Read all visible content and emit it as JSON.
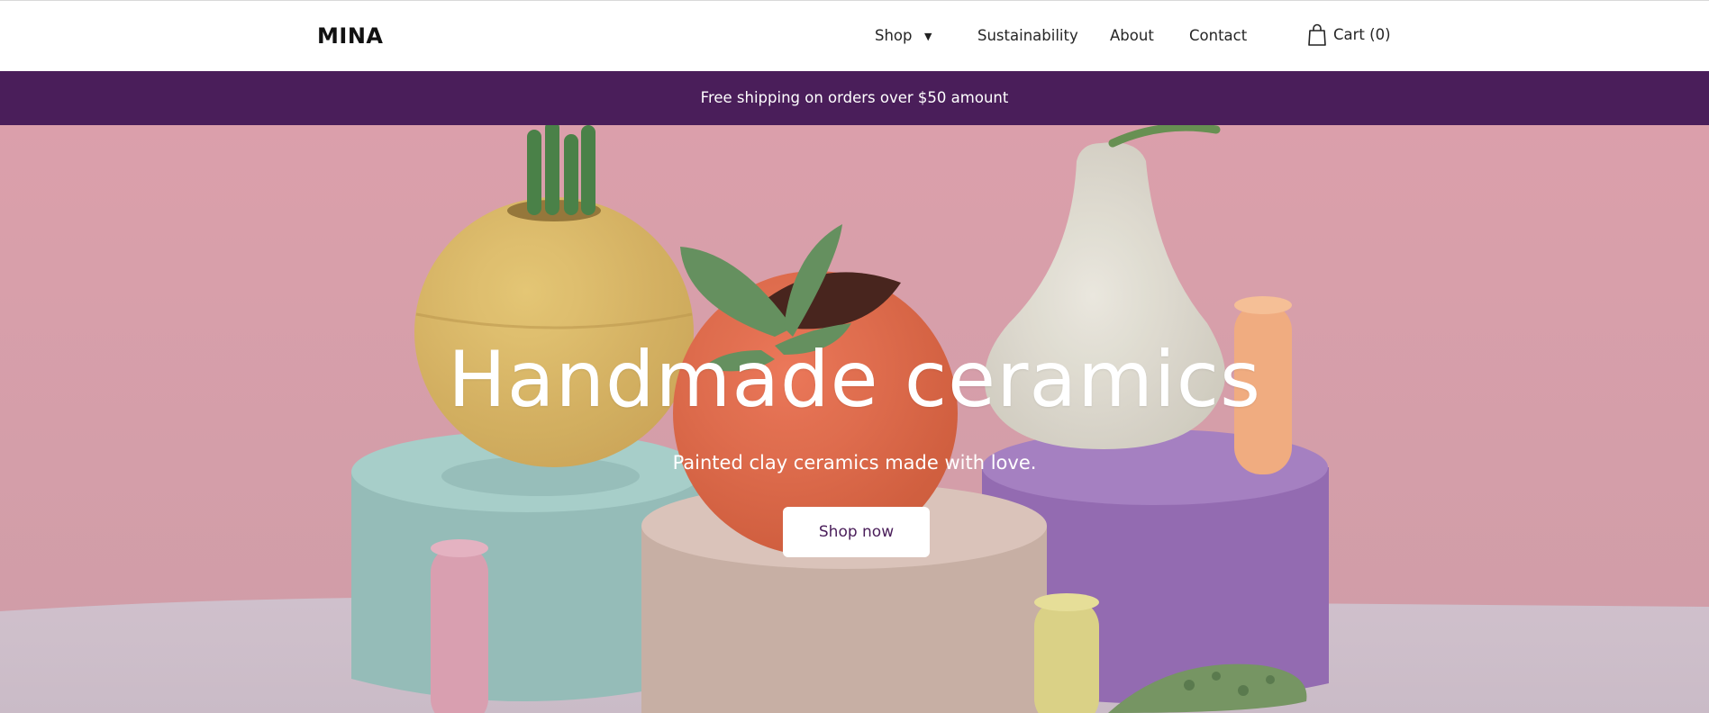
{
  "header": {
    "logo": "MINA",
    "nav": {
      "shop": "Shop",
      "sustainability": "Sustainability",
      "about": "About",
      "contact": "Contact"
    },
    "cart_label": "Cart (0)"
  },
  "announcement": {
    "text": "Free shipping on orders over $50 amount"
  },
  "hero": {
    "title": "Handmade ceramics",
    "subtitle": "Painted clay ceramics made with love.",
    "cta_label": "Shop now"
  },
  "icons": {
    "shop_dropdown": "caret-down-icon",
    "cart": "shopping-bag-icon"
  },
  "colors": {
    "announcement_bg": "#4a1e5a",
    "cta_text": "#4a1e5a",
    "hero_wall": "#d59aa5",
    "hero_floor": "#cbb9c6"
  }
}
